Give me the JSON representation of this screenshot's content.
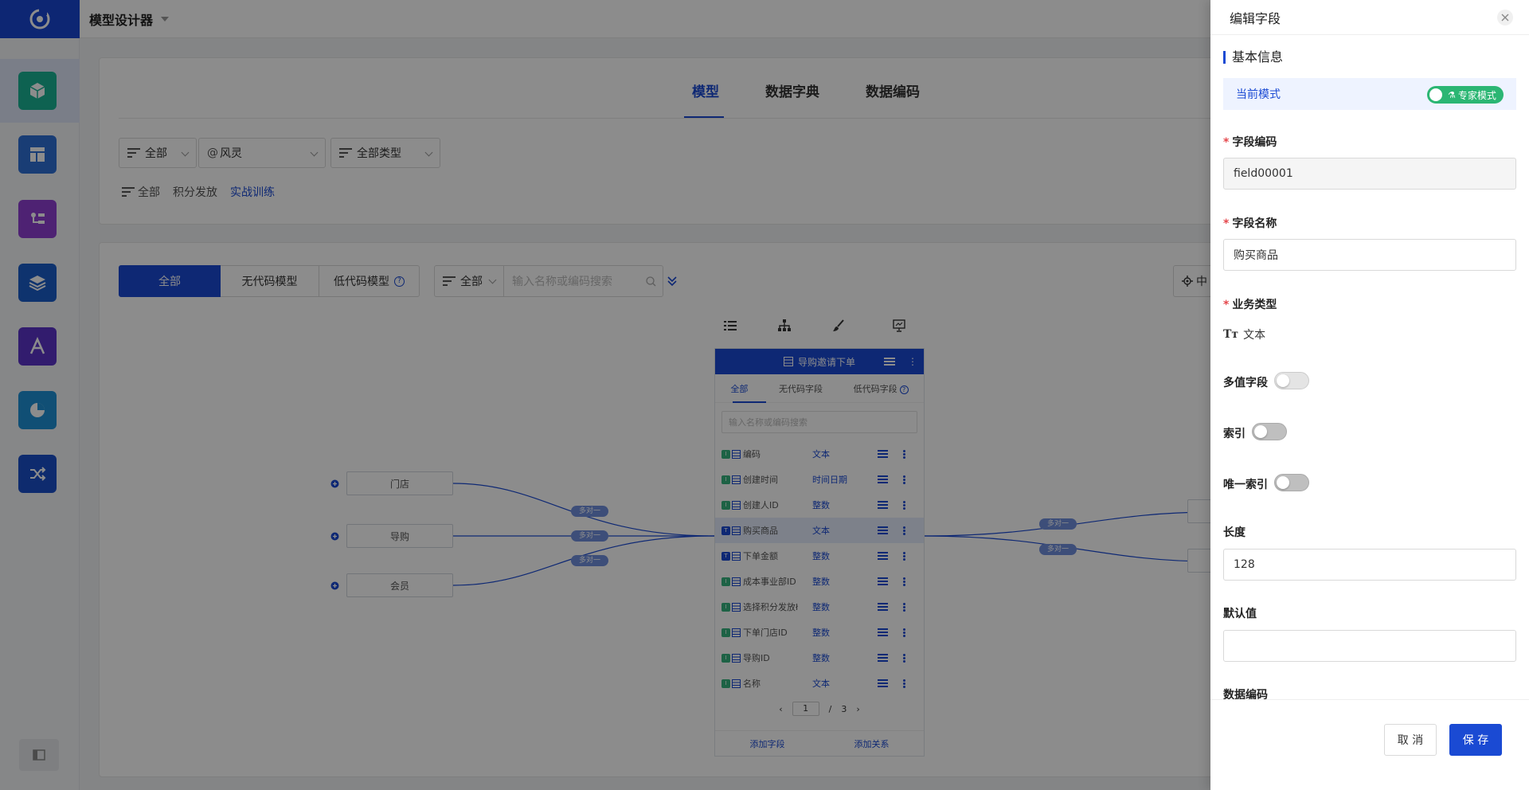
{
  "app": {
    "title": "模型设计器"
  },
  "main_tabs": [
    "模型",
    "数据字典",
    "数据编码"
  ],
  "filters": {
    "scope": "全部",
    "owner": "风灵",
    "type": "全部类型",
    "sub": [
      "全部",
      "积分发放",
      "实战训练"
    ]
  },
  "model_tabs": [
    "全部",
    "无代码模型",
    "低代码模型"
  ],
  "search": {
    "scope": "全部",
    "placeholder": "输入名称或编码搜索"
  },
  "canvas": {
    "right_button_partial": "中",
    "left_nodes": [
      "门店",
      "导购",
      "会员"
    ],
    "relation_label": "多对一"
  },
  "model_card": {
    "title": "导购邀请下单",
    "tabs": [
      "全部",
      "无代码字段",
      "低代码字段"
    ],
    "search_placeholder": "输入名称或编码搜索",
    "fields": [
      {
        "name": "编码",
        "type": "文本",
        "badge": "green"
      },
      {
        "name": "创建时间",
        "type": "时间日期",
        "badge": "green"
      },
      {
        "name": "创建人ID",
        "type": "整数",
        "badge": "green"
      },
      {
        "name": "购买商品",
        "type": "文本",
        "badge": "blue"
      },
      {
        "name": "下单金额",
        "type": "整数",
        "badge": "blue"
      },
      {
        "name": "成本事业部ID",
        "type": "整数",
        "badge": "green"
      },
      {
        "name": "选择积分发放ł",
        "type": "整数",
        "badge": "green"
      },
      {
        "name": "下单门店ID",
        "type": "整数",
        "badge": "green"
      },
      {
        "name": "导购ID",
        "type": "整数",
        "badge": "green"
      },
      {
        "name": "名称",
        "type": "文本",
        "badge": "green"
      }
    ],
    "pager": {
      "current": "1",
      "sep": "/",
      "total": "3"
    },
    "footer": {
      "add_field": "添加字段",
      "add_relation": "添加关系"
    }
  },
  "drawer": {
    "title": "编辑字段",
    "section": "基本信息",
    "mode_label": "当前模式",
    "mode_value": "专家模式",
    "field_code_label": "字段编码",
    "field_code_value": "field00001",
    "field_name_label": "字段名称",
    "field_name_value": "购买商品",
    "biz_type_label": "业务类型",
    "biz_type_value": "文本",
    "multi_label": "多值字段",
    "index_label": "索引",
    "unique_label": "唯一索引",
    "length_label": "长度",
    "length_value": "128",
    "default_label": "默认值",
    "default_value": "",
    "encoding_label": "数据编码",
    "cancel": "取 消",
    "save": "保 存"
  },
  "colors": {
    "primary": "#1a4ad3",
    "success": "#2bb673",
    "required": "#e5484d"
  }
}
